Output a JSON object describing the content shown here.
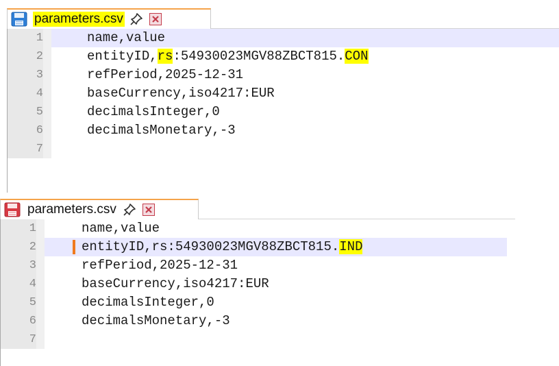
{
  "panel_top": {
    "tab": {
      "filename": "parameters.csv",
      "saved": true
    },
    "lines": [
      {
        "num": "1",
        "text": "name,value"
      },
      {
        "num": "2",
        "pre": "entityID,",
        "mark1": "rs",
        "mid": ":54930023MGV88ZBCT815.",
        "mark2": "CON"
      },
      {
        "num": "3",
        "text": "refPeriod,2025-12-31"
      },
      {
        "num": "4",
        "text": "baseCurrency,iso4217:EUR"
      },
      {
        "num": "5",
        "text": "decimalsInteger,0"
      },
      {
        "num": "6",
        "text": "decimalsMonetary,-3"
      },
      {
        "num": "7",
        "text": ""
      }
    ]
  },
  "panel_bottom": {
    "tab": {
      "filename": "parameters.csv",
      "saved": false
    },
    "lines": [
      {
        "num": "1",
        "text": "name,value"
      },
      {
        "num": "2",
        "pre": "entityID,rs:54930023MGV88ZBCT815.",
        "mark": "IND"
      },
      {
        "num": "3",
        "text": "refPeriod,2025-12-31"
      },
      {
        "num": "4",
        "text": "baseCurrency,iso4217:EUR"
      },
      {
        "num": "5",
        "text": "decimalsInteger,0"
      },
      {
        "num": "6",
        "text": "decimalsMonetary,-3"
      },
      {
        "num": "7",
        "text": ""
      }
    ]
  },
  "colors": {
    "tab_accent": "#f5a34a",
    "selection_highlight": "#ffff00",
    "current_line": "#e8e8ff",
    "change_marker": "#f07a1e",
    "saved_icon": "#2f7fd6",
    "unsaved_icon": "#d83a44"
  },
  "icons": [
    "floppy-disk-saved-icon",
    "floppy-disk-unsaved-icon",
    "pin-icon",
    "close-icon"
  ]
}
